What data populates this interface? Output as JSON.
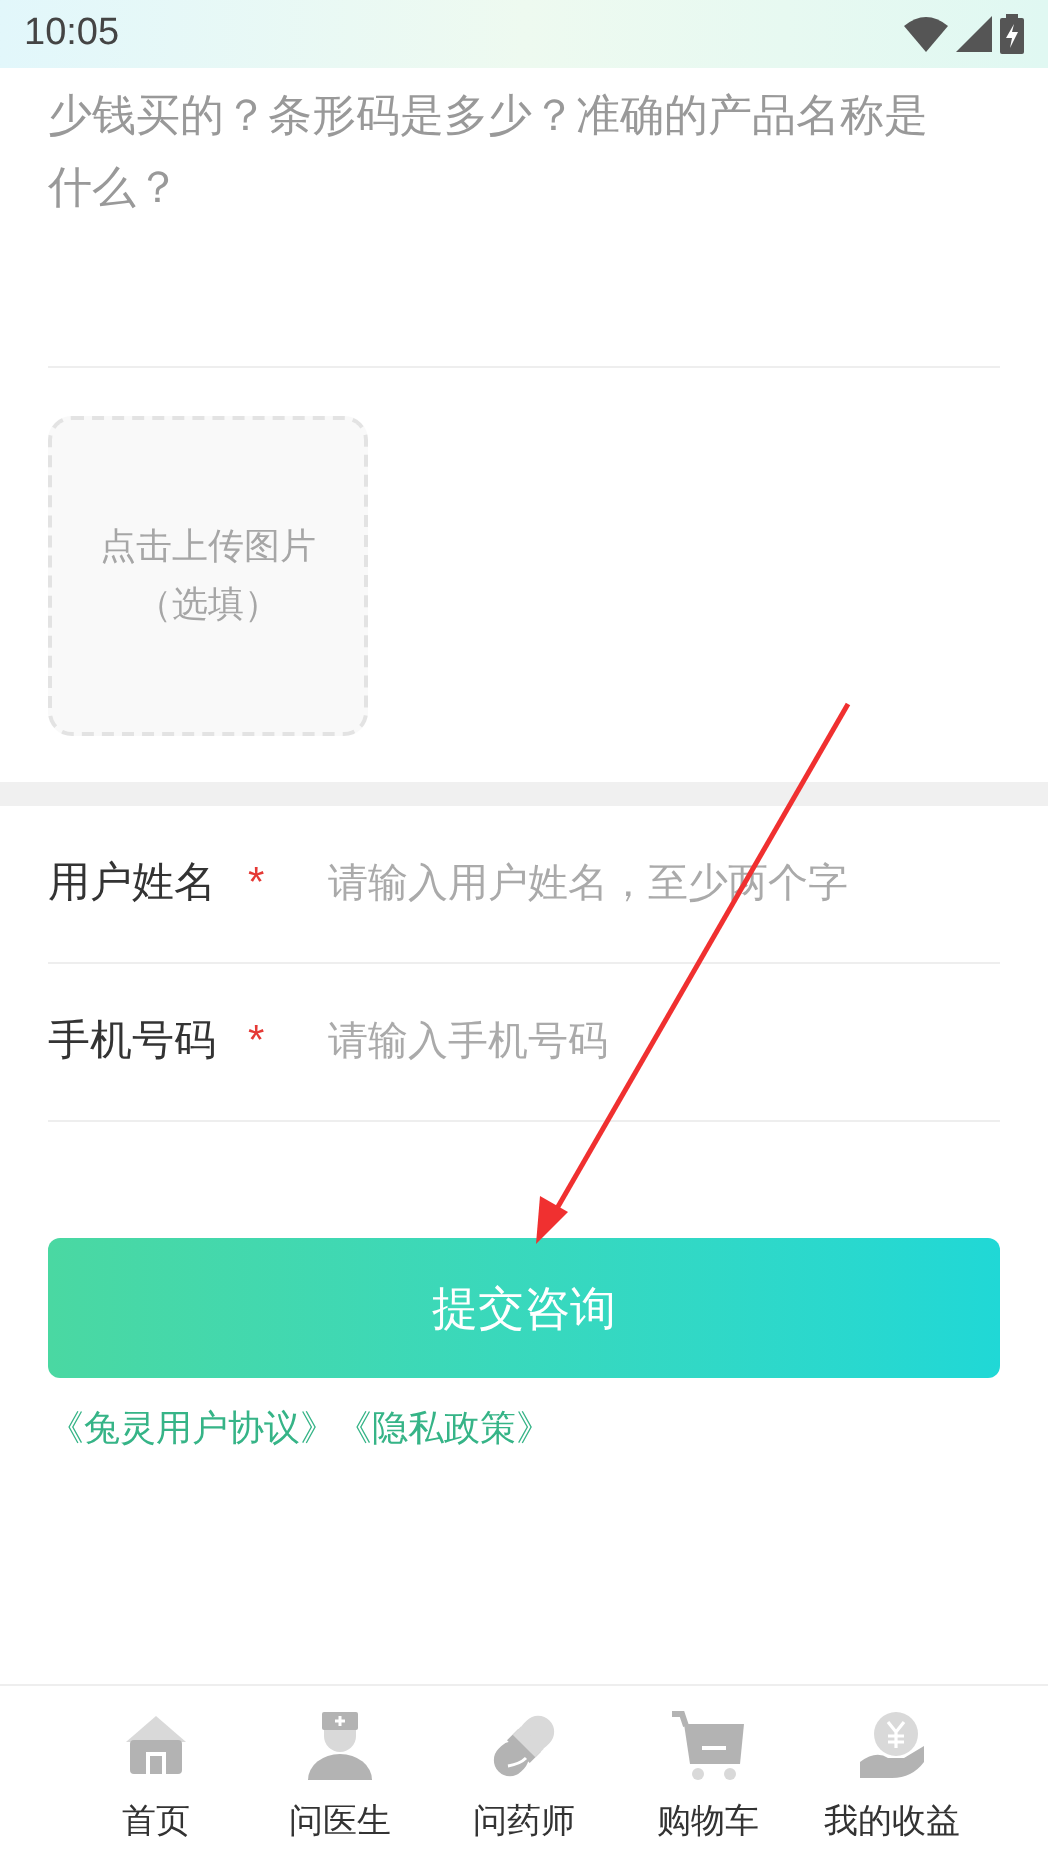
{
  "status_bar": {
    "time": "10:05"
  },
  "question": {
    "text": "少钱买的？条形码是多少？准确的产品名称是什么？"
  },
  "upload": {
    "lines": [
      "点击上传图片",
      "（选填）"
    ]
  },
  "fields": [
    {
      "label": "用户姓名",
      "required_mark": "*",
      "placeholder": "请输入用户姓名，至少两个字"
    },
    {
      "label": "手机号码",
      "required_mark": "*",
      "placeholder": "请输入手机号码"
    }
  ],
  "submit_button": "提交咨询",
  "links": [
    "《兔灵用户协议》",
    "《隐私政策》"
  ],
  "nav": [
    {
      "label": "首页"
    },
    {
      "label": "问医生"
    },
    {
      "label": "问药师"
    },
    {
      "label": "购物车"
    },
    {
      "label": "我的收益"
    }
  ]
}
